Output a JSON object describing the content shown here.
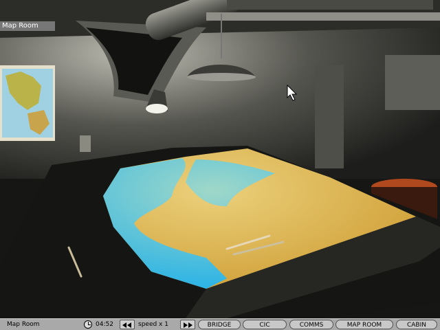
{
  "hud": {
    "location": "Map Room",
    "time": "04:52",
    "speed": "speed x  1",
    "nav": {
      "bridge": "BRIDGE",
      "cic": "CIC",
      "comms": "COMMS",
      "map_room": "MAP ROOM",
      "cabin": "CABIN"
    }
  },
  "icons": {
    "clock": "clock-icon",
    "slower": "rewind-icon",
    "faster": "fast-forward-icon",
    "cursor": "mouse-cursor-icon"
  },
  "colors": {
    "statusbar": "#a9a9a9",
    "sea": "#2bb3e6",
    "land": "#d2a33c"
  }
}
